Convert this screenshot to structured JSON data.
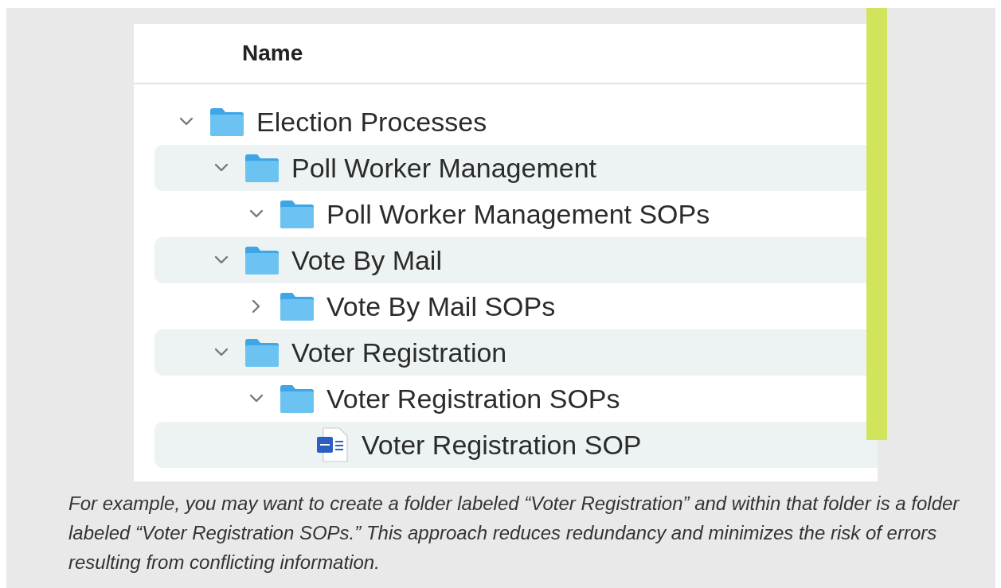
{
  "list": {
    "column_header": "Name",
    "items": [
      {
        "name": "Election Processes",
        "kind": "folder",
        "expanded": true,
        "children": [
          {
            "name": "Poll Worker Management",
            "kind": "folder",
            "expanded": true,
            "children": [
              {
                "name": "Poll Worker Management SOPs",
                "kind": "folder",
                "expanded": true
              }
            ]
          },
          {
            "name": "Vote By Mail",
            "kind": "folder",
            "expanded": true,
            "children": [
              {
                "name": "Vote By Mail SOPs",
                "kind": "folder",
                "expanded": false
              }
            ]
          },
          {
            "name": "Voter Registration",
            "kind": "folder",
            "expanded": true,
            "children": [
              {
                "name": "Voter Registration SOPs",
                "kind": "folder",
                "expanded": true,
                "children": [
                  {
                    "name": "Voter Registration SOP",
                    "kind": "file"
                  }
                ]
              }
            ]
          }
        ]
      }
    ]
  },
  "caption": "For example, you may want to create a folder labeled “Voter Registration” and within that folder is a folder labeled “Voter Registration SOPs.” This approach reduces redundancy and minimizes the risk of errors resulting from conflicting information."
}
